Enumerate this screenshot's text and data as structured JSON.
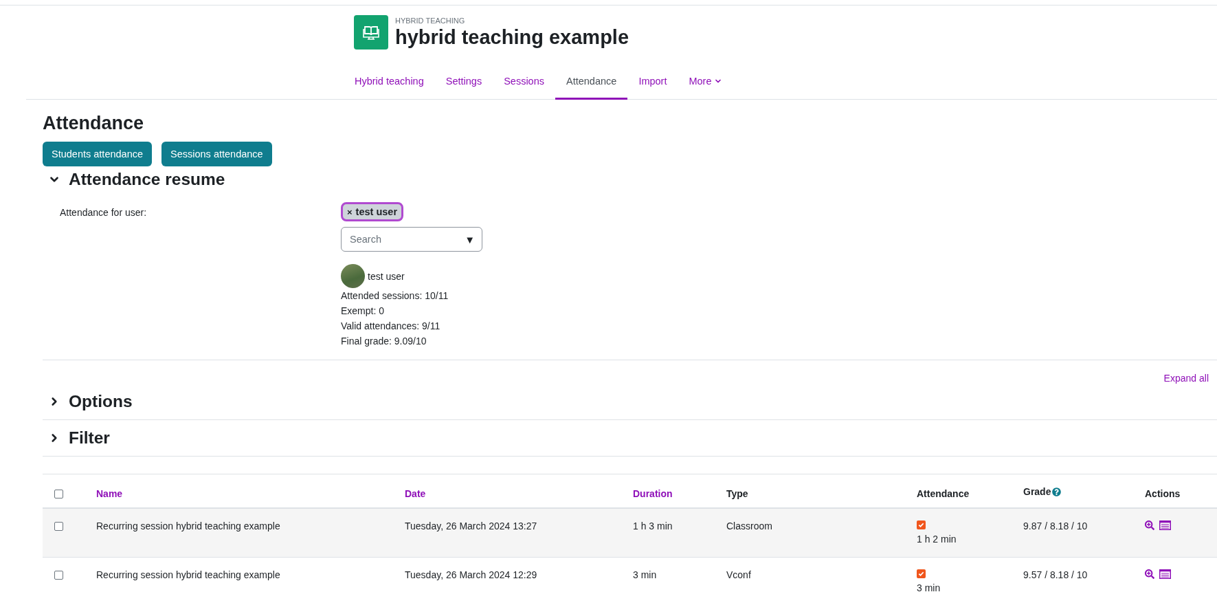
{
  "header": {
    "kicker": "HYBRID TEACHING",
    "title": "hybrid teaching example"
  },
  "tabs": [
    {
      "label": "Hybrid teaching",
      "selected": false,
      "kind": "link"
    },
    {
      "label": "Settings",
      "selected": false,
      "kind": "link"
    },
    {
      "label": "Sessions",
      "selected": false,
      "kind": "link"
    },
    {
      "label": "Attendance",
      "selected": true,
      "kind": "link"
    },
    {
      "label": "Import",
      "selected": false,
      "kind": "link"
    },
    {
      "label": "More",
      "selected": false,
      "kind": "menu"
    }
  ],
  "page_title": "Attendance",
  "view_buttons": [
    "Students attendance",
    "Sessions attendance"
  ],
  "resume": {
    "heading": "Attendance resume",
    "expanded": true,
    "user_label": "Attendance for user:",
    "selected_user": {
      "remove": "×",
      "name": "test user"
    },
    "search": {
      "placeholder": "Search",
      "toggle": "▼"
    },
    "user": {
      "name": "test user"
    },
    "stats": [
      "Attended sessions: 10/11",
      "Exempt: 0",
      "Valid attendances: 9/11",
      "Final grade: 9.09/10"
    ]
  },
  "expand_all": "Expand all",
  "sections": [
    {
      "heading": "Options",
      "expanded": false
    },
    {
      "heading": "Filter",
      "expanded": false
    }
  ],
  "table": {
    "select_all": {
      "checked": false
    },
    "columns": [
      {
        "label": "Name",
        "sortable": true
      },
      {
        "label": "Date",
        "sortable": true
      },
      {
        "label": "Duration",
        "sortable": true
      },
      {
        "label": "Type",
        "sortable": false
      },
      {
        "label": "Attendance",
        "sortable": false
      },
      {
        "label": "Grade",
        "sortable": false,
        "help": true
      },
      {
        "label": "Actions",
        "sortable": false
      }
    ],
    "rows": [
      {
        "checked": false,
        "name": "Recurring session hybrid teaching example",
        "date": "Tuesday, 26 March 2024 13:27",
        "duration": "1 h 3 min",
        "type": "Classroom",
        "attended": true,
        "attendance_time": "1 h 2 min",
        "grade": "9.87 / 8.18 / 10"
      },
      {
        "checked": false,
        "name": "Recurring session hybrid teaching example",
        "date": "Tuesday, 26 March 2024 12:29",
        "duration": "3 min",
        "type": "Vconf",
        "attended": true,
        "attendance_time": "3 min",
        "grade": "9.57 / 8.18 / 10"
      }
    ]
  }
}
